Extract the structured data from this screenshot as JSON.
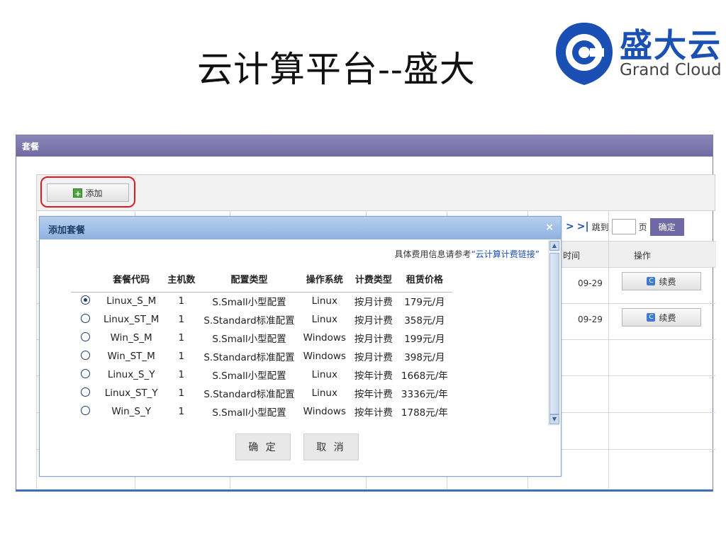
{
  "slide": {
    "title": "云计算平台--盛大"
  },
  "logo": {
    "cn": "盛大云",
    "en": "Grand Cloud",
    "brand_color": "#1a4fb3"
  },
  "panel": {
    "title": "套餐"
  },
  "toolbar": {
    "add_label": "添加"
  },
  "pager": {
    "next": ">",
    "last": ">|",
    "jump_label": "跳到",
    "page_value": "",
    "page_suffix": "页",
    "confirm": "确定"
  },
  "grid": {
    "headers": {
      "time": "时间",
      "action": "操作"
    },
    "rows": [
      {
        "time": "09-29",
        "action": "续费"
      },
      {
        "time": "09-29",
        "action": "续费"
      }
    ]
  },
  "dialog": {
    "title": "添加套餐",
    "close": "×",
    "note_prefix": "具体费用信息请参考",
    "note_link": "“云计算计费链接”",
    "columns": [
      "套餐代码",
      "主机数",
      "配置类型",
      "操作系统",
      "计费类型",
      "租赁价格"
    ],
    "rows": [
      {
        "selected": true,
        "code": "Linux_S_M",
        "hosts": "1",
        "config": "S.Small小型配置",
        "os": "Linux",
        "billing": "按月计费",
        "price": "179元/月"
      },
      {
        "selected": false,
        "code": "Linux_ST_M",
        "hosts": "1",
        "config": "S.Standard标准配置",
        "os": "Linux",
        "billing": "按月计费",
        "price": "358元/月"
      },
      {
        "selected": false,
        "code": "Win_S_M",
        "hosts": "1",
        "config": "S.Small小型配置",
        "os": "Windows",
        "billing": "按月计费",
        "price": "199元/月"
      },
      {
        "selected": false,
        "code": "Win_ST_M",
        "hosts": "1",
        "config": "S.Standard标准配置",
        "os": "Windows",
        "billing": "按月计费",
        "price": "398元/月"
      },
      {
        "selected": false,
        "code": "Linux_S_Y",
        "hosts": "1",
        "config": "S.Small小型配置",
        "os": "Linux",
        "billing": "按年计费",
        "price": "1668元/年"
      },
      {
        "selected": false,
        "code": "Linux_ST_Y",
        "hosts": "1",
        "config": "S.Standard标准配置",
        "os": "Linux",
        "billing": "按年计费",
        "price": "3336元/年"
      },
      {
        "selected": false,
        "code": "Win_S_Y",
        "hosts": "1",
        "config": "S.Small小型配置",
        "os": "Windows",
        "billing": "按年计费",
        "price": "1788元/年"
      }
    ],
    "ok_label": "确 定",
    "cancel_label": "取 消"
  }
}
